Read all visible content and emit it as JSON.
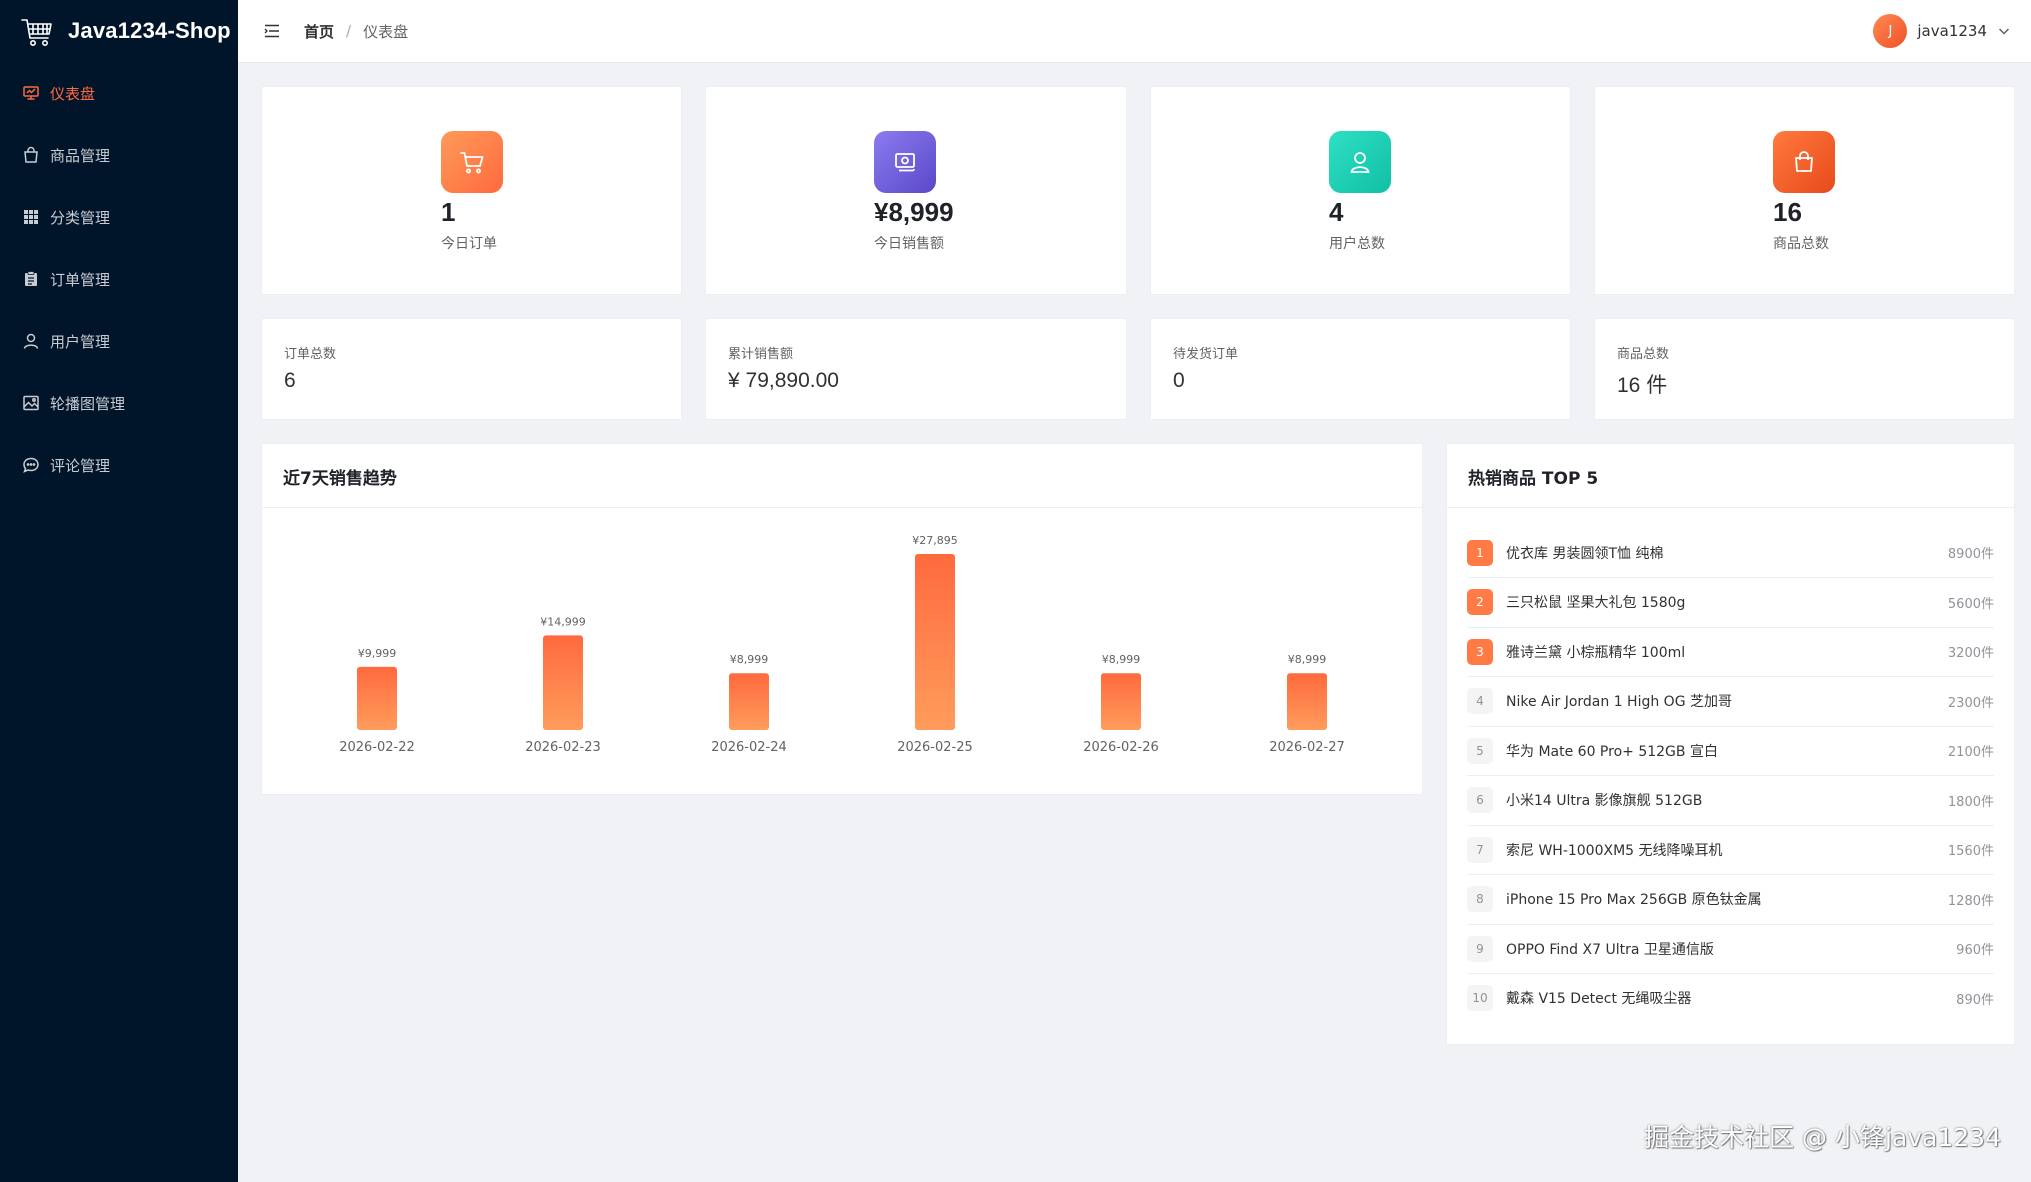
{
  "app": {
    "title": "Java1234-Shop"
  },
  "sidebar": {
    "items": [
      {
        "label": "仪表盘",
        "icon": "monitor-icon",
        "active": true
      },
      {
        "label": "商品管理",
        "icon": "shopping-bag-icon",
        "active": false
      },
      {
        "label": "分类管理",
        "icon": "grid-icon",
        "active": false
      },
      {
        "label": "订单管理",
        "icon": "clipboard-icon",
        "active": false
      },
      {
        "label": "用户管理",
        "icon": "user-icon",
        "active": false
      },
      {
        "label": "轮播图管理",
        "icon": "picture-icon",
        "active": false
      },
      {
        "label": "评论管理",
        "icon": "chat-icon",
        "active": false
      }
    ]
  },
  "header": {
    "breadcrumb": {
      "home": "首页",
      "separator": "/",
      "current": "仪表盘"
    },
    "user": {
      "avatar_letter": "J",
      "name": "java1234"
    }
  },
  "stats": [
    {
      "value": "1",
      "label": "今日订单",
      "icon": "cart-icon",
      "color": "#ff7a45"
    },
    {
      "value": "¥8,999",
      "label": "今日销售额",
      "icon": "money-icon",
      "color": "#6c5ce7"
    },
    {
      "value": "4",
      "label": "用户总数",
      "icon": "user-icon",
      "color": "#1ccfb5"
    },
    {
      "value": "16",
      "label": "商品总数",
      "icon": "bag-icon",
      "color": "#f25a2c"
    }
  ],
  "summary": [
    {
      "label": "订单总数",
      "value": "6"
    },
    {
      "label": "累计销售额",
      "value": "¥ 79,890.00"
    },
    {
      "label": "待发货订单",
      "value": "0"
    },
    {
      "label": "商品总数",
      "value": "16 件"
    }
  ],
  "sales_panel": {
    "title": "近7天销售趋势"
  },
  "chart_data": {
    "type": "bar",
    "categories": [
      "2026-02-22",
      "2026-02-23",
      "2026-02-24",
      "2026-02-25",
      "2026-02-26",
      "2026-02-27"
    ],
    "values": [
      9999,
      14999,
      8999,
      27895,
      8999,
      8999
    ],
    "labels": [
      "¥9,999",
      "¥14,999",
      "¥8,999",
      "¥27,895",
      "¥8,999",
      "¥8,999"
    ],
    "title": "近7天销售趋势",
    "color": "#ff7a45",
    "grid": false
  },
  "top_panel": {
    "title": "热销商品 TOP 5",
    "items": [
      {
        "rank": "1",
        "name": "优衣库 男装圆领T恤 纯棉",
        "sales": "8900件"
      },
      {
        "rank": "2",
        "name": "三只松鼠 坚果大礼包 1580g",
        "sales": "5600件"
      },
      {
        "rank": "3",
        "name": "雅诗兰黛 小棕瓶精华 100ml",
        "sales": "3200件"
      },
      {
        "rank": "4",
        "name": "Nike Air Jordan 1 High OG 芝加哥",
        "sales": "2300件"
      },
      {
        "rank": "5",
        "name": "华为 Mate 60 Pro+ 512GB 宣白",
        "sales": "2100件"
      },
      {
        "rank": "6",
        "name": "小米14 Ultra 影像旗舰 512GB",
        "sales": "1800件"
      },
      {
        "rank": "7",
        "name": "索尼 WH-1000XM5 无线降噪耳机",
        "sales": "1560件"
      },
      {
        "rank": "8",
        "name": "iPhone 15 Pro Max 256GB 原色钛金属",
        "sales": "1280件"
      },
      {
        "rank": "9",
        "name": "OPPO Find X7 Ultra 卫星通信版",
        "sales": "960件"
      },
      {
        "rank": "10",
        "name": "戴森 V15 Detect 无绳吸尘器",
        "sales": "890件"
      }
    ]
  },
  "watermark": "掘金技术社区 @ 小锋java1234"
}
